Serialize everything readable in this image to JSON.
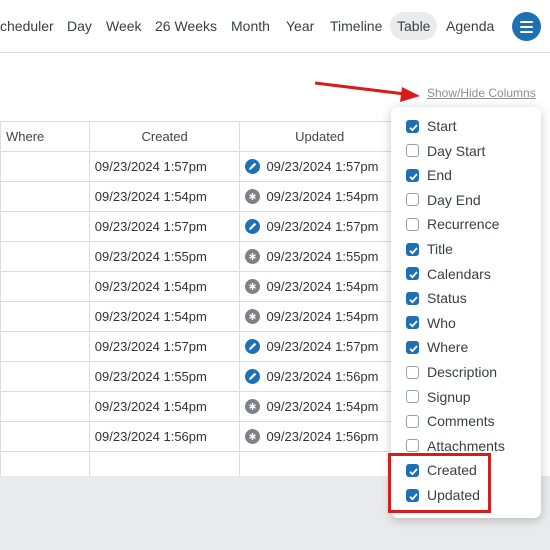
{
  "nav": {
    "scheduler": "cheduler",
    "day": "Day",
    "week": "Week",
    "weeks26": "26 Weeks",
    "month": "Month",
    "year": "Year",
    "timeline": "Timeline",
    "table": "Table",
    "agenda": "Agenda"
  },
  "showhide_label": "Show/Hide Columns",
  "table": {
    "headers": {
      "where": "Where",
      "created": "Created",
      "updated": "Updated"
    },
    "rows": [
      {
        "created": "09/23/2024 1:57pm",
        "updated": "09/23/2024 1:57pm",
        "icon": "edit-icon"
      },
      {
        "created": "09/23/2024 1:54pm",
        "updated": "09/23/2024 1:54pm",
        "icon": "auto-icon"
      },
      {
        "created": "09/23/2024 1:57pm",
        "updated": "09/23/2024 1:57pm",
        "icon": "edit-icon"
      },
      {
        "created": "09/23/2024 1:55pm",
        "updated": "09/23/2024 1:55pm",
        "icon": "auto-icon"
      },
      {
        "created": "09/23/2024 1:54pm",
        "updated": "09/23/2024 1:54pm",
        "icon": "auto-icon"
      },
      {
        "created": "09/23/2024 1:54pm",
        "updated": "09/23/2024 1:54pm",
        "icon": "auto-icon"
      },
      {
        "created": "09/23/2024 1:57pm",
        "updated": "09/23/2024 1:57pm",
        "icon": "edit-icon"
      },
      {
        "created": "09/23/2024 1:55pm",
        "updated": "09/23/2024 1:56pm",
        "icon": "edit-icon"
      },
      {
        "created": "09/23/2024 1:54pm",
        "updated": "09/23/2024 1:54pm",
        "icon": "auto-icon"
      },
      {
        "created": "09/23/2024 1:56pm",
        "updated": "09/23/2024 1:56pm",
        "icon": "auto-icon"
      }
    ]
  },
  "columns_menu": [
    {
      "label": "Start",
      "checked": true
    },
    {
      "label": "Day Start",
      "checked": false
    },
    {
      "label": "End",
      "checked": true
    },
    {
      "label": "Day End",
      "checked": false
    },
    {
      "label": "Recurrence",
      "checked": false
    },
    {
      "label": "Title",
      "checked": true
    },
    {
      "label": "Calendars",
      "checked": true
    },
    {
      "label": "Status",
      "checked": true
    },
    {
      "label": "Who",
      "checked": true
    },
    {
      "label": "Where",
      "checked": true
    },
    {
      "label": "Description",
      "checked": false
    },
    {
      "label": "Signup",
      "checked": false
    },
    {
      "label": "Comments",
      "checked": false
    },
    {
      "label": "Attachments",
      "checked": false
    },
    {
      "label": "Created",
      "checked": true
    },
    {
      "label": "Updated",
      "checked": true
    }
  ],
  "colors": {
    "accent": "#1f6fb5",
    "annotation_red": "#d61d1d",
    "auto_icon_gray": "#7d8288"
  }
}
